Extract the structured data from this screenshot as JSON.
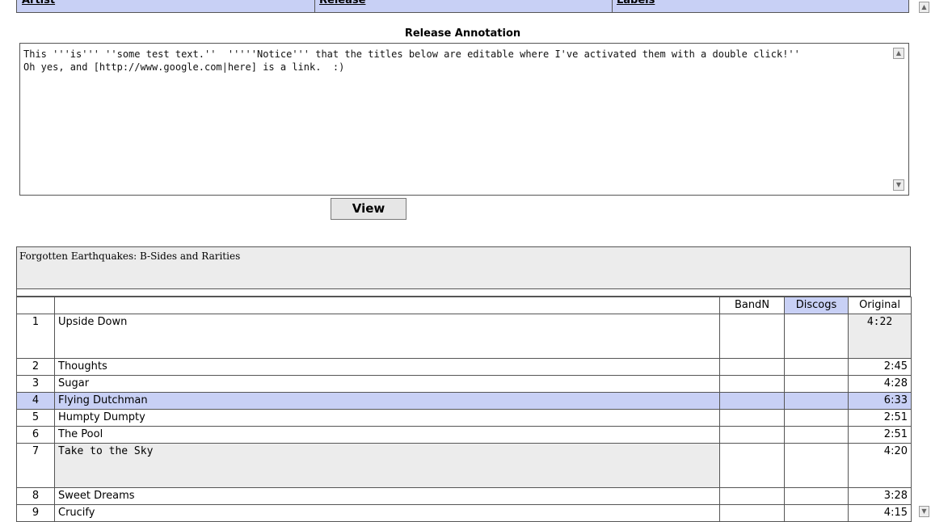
{
  "header_tabs": [
    {
      "label": "Artist"
    },
    {
      "label": "Release"
    },
    {
      "label": "Labels"
    }
  ],
  "annotation": {
    "title": "Release Annotation",
    "text": "This '''is''' ''some test text.''  '''''Notice''' that the titles below are editable where I've activated them with a double click!''\nOh yes, and [http://www.google.com|here] is a link.  :)"
  },
  "view_button": "View",
  "release": {
    "title": "Forgotten Earthquakes: B-Sides and Rarities"
  },
  "columns": {
    "bandn": "BandN",
    "discogs": "Discogs",
    "original": "Original"
  },
  "tracks": [
    {
      "num": "1",
      "title": "Upside Down",
      "length": "4:22"
    },
    {
      "num": "2",
      "title": "Thoughts",
      "length": "2:45"
    },
    {
      "num": "3",
      "title": "Sugar",
      "length": "4:28"
    },
    {
      "num": "4",
      "title": "Flying Dutchman",
      "length": "6:33"
    },
    {
      "num": "5",
      "title": "Humpty Dumpty",
      "length": "2:51"
    },
    {
      "num": "6",
      "title": "The Pool",
      "length": "2:51"
    },
    {
      "num": "7",
      "title": "Take to the Sky",
      "length": "4:20"
    },
    {
      "num": "8",
      "title": "Sweet Dreams",
      "length": "3:28"
    },
    {
      "num": "9",
      "title": "Crucify",
      "length": "4:15"
    }
  ],
  "colors": {
    "highlight": "#c8d0f5",
    "editable_bg": "#ececec"
  }
}
